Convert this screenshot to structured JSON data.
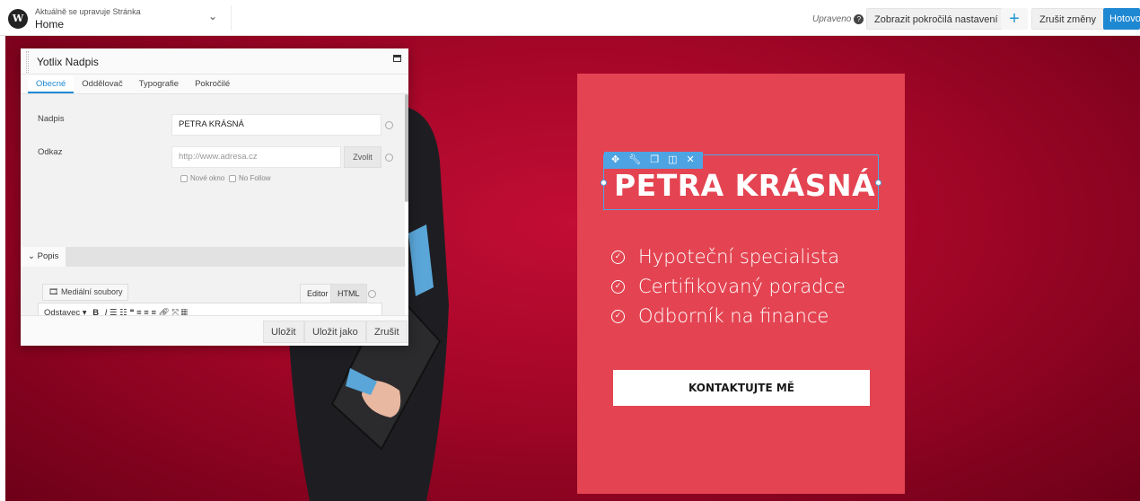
{
  "topbar": {
    "editing_label": "Aktuálně se upravuje Stránka",
    "page_name": "Home",
    "saved_status": "Upraveno",
    "advanced_label": "Zobrazit pokročilá nastavení",
    "add_label": "+",
    "discard_label": "Zrušit změny",
    "done_label": "Hotovo"
  },
  "panel": {
    "title": "Yotlix Nadpis",
    "tabs": [
      "Obecné",
      "Oddělovač",
      "Typografie",
      "Pokročilé"
    ],
    "fields": {
      "heading_label": "Nadpis",
      "heading_value": "PETRA KRÁSNÁ",
      "link_label": "Odkaz",
      "link_placeholder": "http://www.adresa.cz",
      "choose_label": "Zvolit",
      "new_window_label": "Nové okno",
      "nofollow_label": "No Follow"
    },
    "description_section": "Popis",
    "media_button": "Mediální soubory",
    "editor_tab": "Editor",
    "html_tab": "HTML",
    "format_select": "Odstavec",
    "footer": {
      "save": "Uložit",
      "save_as": "Uložit jako",
      "cancel": "Zrušit"
    }
  },
  "card": {
    "headline": "PETRA KRÁSNÁ",
    "features": [
      "Hypoteční specialista",
      "Certifikovaný poradce",
      "Odborník na finance"
    ],
    "cta": "KONTAKTUJTE MĚ"
  },
  "colors": {
    "accent_blue": "#1e88d3",
    "card_red": "#e44452",
    "background_red": "#a40628"
  }
}
